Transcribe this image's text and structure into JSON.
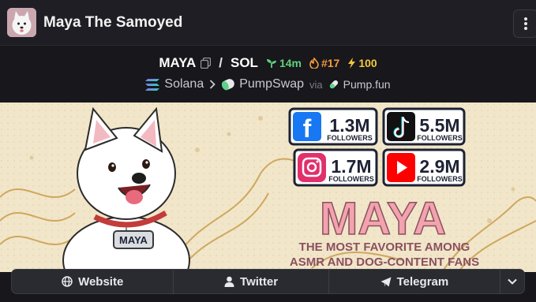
{
  "header": {
    "title": "Maya The Samoyed",
    "avatar_icon": "samoyed-avatar-icon",
    "menu_icon": "vertical-dots-icon"
  },
  "pair": {
    "base": "MAYA",
    "quote": "SOL",
    "separator": "/",
    "copy_icon": "copy-icon",
    "age": "14m",
    "rank": "#17",
    "boosts": "100"
  },
  "chain": {
    "name": "Solana",
    "dex": "PumpSwap",
    "via_label": "via",
    "launchpad": "Pump.fun"
  },
  "banner": {
    "platforms": [
      {
        "name": "facebook",
        "count": "1.3M",
        "label": "FOLLOWERS"
      },
      {
        "name": "tiktok",
        "count": "5.5M",
        "label": "FOLLOWERS"
      },
      {
        "name": "instagram",
        "count": "1.7M",
        "label": "FOLLOWERS"
      },
      {
        "name": "youtube",
        "count": "2.9M",
        "label": "FOLLOWERS"
      }
    ],
    "headline": "MAYA",
    "tagline_1": "THE MOST FAVORITE AMONG",
    "tagline_2": "ASMR AND DOG-CONTENT FANS",
    "tag_text": "MAYA"
  },
  "links": {
    "website": "Website",
    "twitter": "Twitter",
    "telegram": "Telegram"
  },
  "colors": {
    "green": "#61d17a",
    "orange": "#f59a3c",
    "yellow": "#f5c73c",
    "headline_pink": "#f2a3ad"
  }
}
